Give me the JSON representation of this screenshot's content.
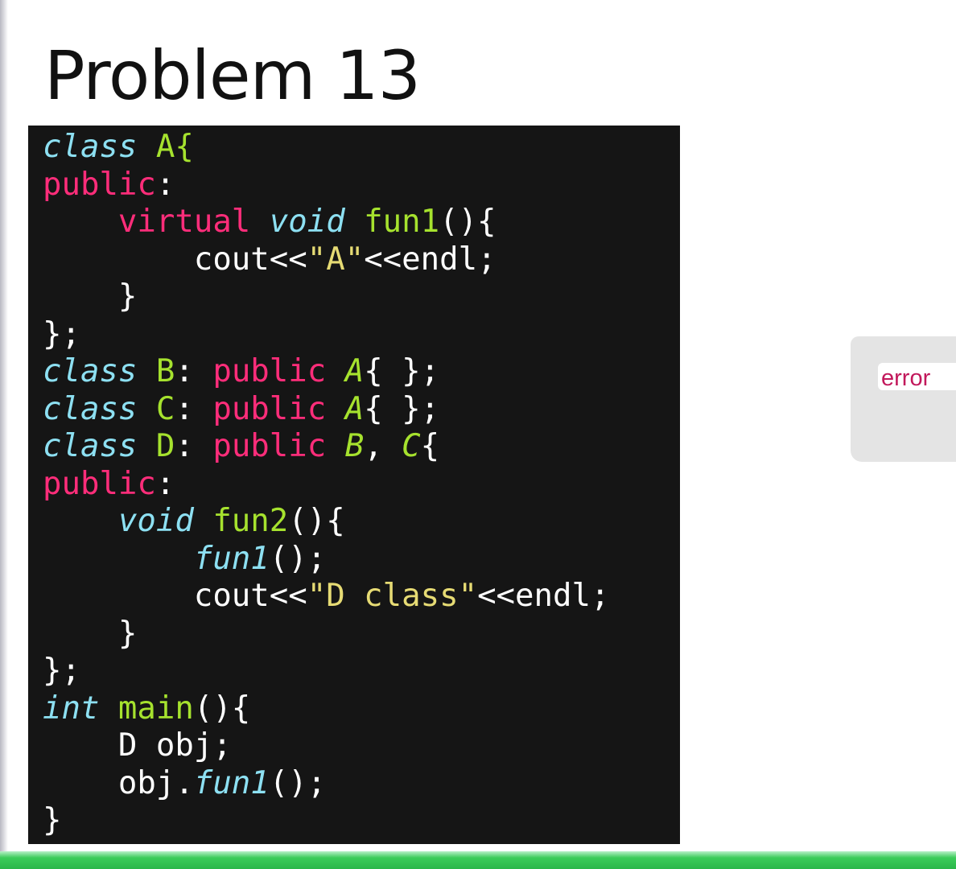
{
  "slide": {
    "title": "Problem 13"
  },
  "code_lines": [
    [
      {
        "t": "class ",
        "c": "kw"
      },
      {
        "t": "A{",
        "c": "green"
      }
    ],
    [
      {
        "t": "public",
        "c": "pink"
      },
      {
        "t": ":",
        "c": "white"
      }
    ],
    [
      {
        "t": "    ",
        "c": "white"
      },
      {
        "t": "virtual ",
        "c": "pink"
      },
      {
        "t": "void ",
        "c": "kw"
      },
      {
        "t": "fun1",
        "c": "green"
      },
      {
        "t": "(){",
        "c": "white"
      }
    ],
    [
      {
        "t": "        cout<<",
        "c": "white"
      },
      {
        "t": "\"A\"",
        "c": "yellow"
      },
      {
        "t": "<<endl;",
        "c": "white"
      }
    ],
    [
      {
        "t": "    }",
        "c": "white"
      }
    ],
    [
      {
        "t": "};",
        "c": "white"
      }
    ],
    [
      {
        "t": "class ",
        "c": "kw"
      },
      {
        "t": "B",
        "c": "green"
      },
      {
        "t": ": ",
        "c": "white"
      },
      {
        "t": "public ",
        "c": "pink"
      },
      {
        "t": "A",
        "c": "ital-green"
      },
      {
        "t": "{ };",
        "c": "white"
      }
    ],
    [
      {
        "t": "class ",
        "c": "kw"
      },
      {
        "t": "C",
        "c": "green"
      },
      {
        "t": ": ",
        "c": "white"
      },
      {
        "t": "public ",
        "c": "pink"
      },
      {
        "t": "A",
        "c": "ital-green"
      },
      {
        "t": "{ };",
        "c": "white"
      }
    ],
    [
      {
        "t": "class ",
        "c": "kw"
      },
      {
        "t": "D",
        "c": "green"
      },
      {
        "t": ": ",
        "c": "white"
      },
      {
        "t": "public ",
        "c": "pink"
      },
      {
        "t": "B",
        "c": "ital-green"
      },
      {
        "t": ", ",
        "c": "white"
      },
      {
        "t": "C",
        "c": "ital-green"
      },
      {
        "t": "{",
        "c": "white"
      }
    ],
    [
      {
        "t": "public",
        "c": "pink"
      },
      {
        "t": ":",
        "c": "white"
      }
    ],
    [
      {
        "t": "    ",
        "c": "white"
      },
      {
        "t": "void ",
        "c": "kw"
      },
      {
        "t": "fun2",
        "c": "green"
      },
      {
        "t": "(){",
        "c": "white"
      }
    ],
    [
      {
        "t": "        ",
        "c": "white"
      },
      {
        "t": "fun1",
        "c": "kw"
      },
      {
        "t": "();",
        "c": "white"
      }
    ],
    [
      {
        "t": "        cout<<",
        "c": "white"
      },
      {
        "t": "\"D class\"",
        "c": "yellow"
      },
      {
        "t": "<<endl;",
        "c": "white"
      }
    ],
    [
      {
        "t": "    }",
        "c": "white"
      }
    ],
    [
      {
        "t": "};",
        "c": "white"
      }
    ],
    [
      {
        "t": "int ",
        "c": "kw"
      },
      {
        "t": "main",
        "c": "green"
      },
      {
        "t": "(){",
        "c": "white"
      }
    ],
    [
      {
        "t": "    D obj;",
        "c": "white"
      }
    ],
    [
      {
        "t": "    obj.",
        "c": "white"
      },
      {
        "t": "fun1",
        "c": "kw"
      },
      {
        "t": "();",
        "c": "white"
      }
    ],
    [
      {
        "t": "}",
        "c": "white"
      }
    ]
  ],
  "answer": {
    "text": "error"
  },
  "colors": {
    "panel_bg": "#151515",
    "keyword_cyan": "#8de0f2",
    "access_pink": "#ff2d7a",
    "name_green": "#a6e22e",
    "string_yellow": "#e6db74",
    "answer_text": "#c2185b",
    "bottom_bar": "#2bb64a"
  }
}
